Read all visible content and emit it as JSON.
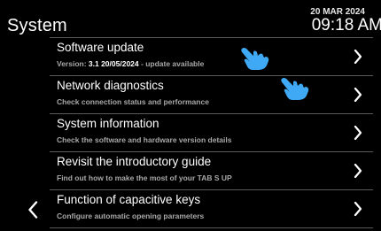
{
  "header": {
    "title": "System",
    "date": "20 MAR 2024",
    "time": "09:18 AM"
  },
  "items": [
    {
      "title": "Software update",
      "subtitle_prefix": "Version: ",
      "subtitle_highlight": "3.1 20/05/2024",
      "subtitle_suffix": " - update available"
    },
    {
      "title": "Network diagnostics",
      "subtitle": "Check connection status and performance"
    },
    {
      "title": "System information",
      "subtitle": "Check the software and hardware version details"
    },
    {
      "title": "Revisit the introductory guide",
      "subtitle": "Find out how to make the most of your TAB S UP"
    },
    {
      "title": "Function of capacitive keys",
      "subtitle": "Configure automatic opening parameters"
    }
  ],
  "icons": {
    "chevron": "chevron-right-icon",
    "back": "chevron-left-icon",
    "pointer": "pointing-hand-icon"
  },
  "colors": {
    "background": "#000000",
    "text": "#ffffff",
    "subtext": "#a8a8a8",
    "divider": "#5a5a5a",
    "pointer": "#3fa9f5"
  }
}
